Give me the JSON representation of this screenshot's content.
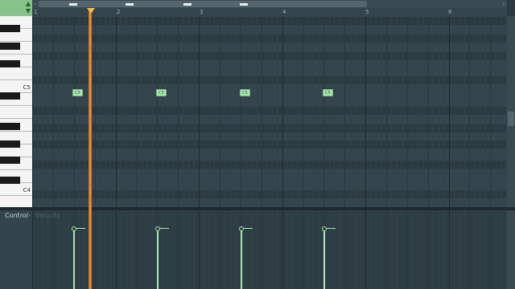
{
  "ruler": {
    "bars": [
      "1",
      "2",
      "3",
      "4",
      "5",
      "6"
    ]
  },
  "keyboard": {
    "labels": {
      "c5": "C5",
      "c4": "C4"
    }
  },
  "notes": [
    {
      "label": "C5"
    },
    {
      "label": "C5"
    },
    {
      "label": "C5"
    },
    {
      "label": "C5"
    }
  ],
  "event_editor": {
    "control_label": "Control",
    "arrow": "›",
    "parameter": "Velocity"
  },
  "scroll": {
    "left_arrow": "‹",
    "right_arrow": "›"
  },
  "colors": {
    "note_fill": "#a9e7b1",
    "playhead": "#f3a14a",
    "grid_bg": "#34454d",
    "accent_green": "#86c38a"
  }
}
